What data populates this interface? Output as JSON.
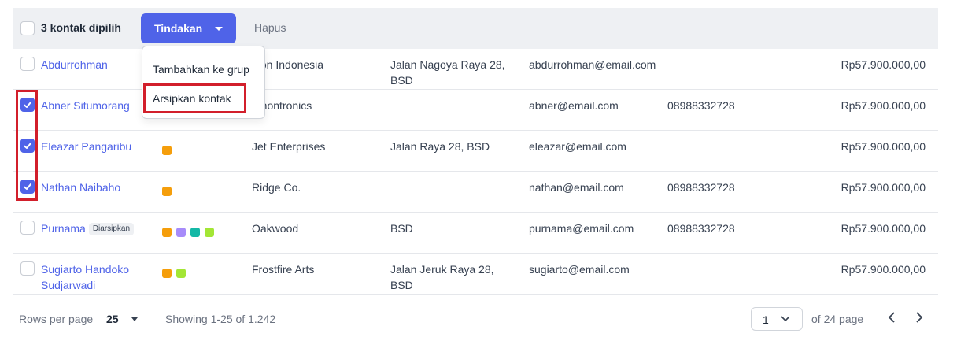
{
  "header": {
    "selected_text": "3 kontak dipilih",
    "actions_label": "Tindakan",
    "delete_label": "Hapus"
  },
  "dropdown": {
    "items": [
      "Tambahkan ke grup",
      "Arsipkan kontak"
    ]
  },
  "rows": [
    {
      "name": "Abdurrohman",
      "checked": false,
      "tags": [],
      "company": "Lion Indonesia",
      "address": "Jalan Nagoya Raya 28, BSD",
      "email": "abdurrohman@email.com",
      "phone": "",
      "amount": "Rp57.900.000,00"
    },
    {
      "name": "Abner Situmorang",
      "checked": true,
      "tags": [],
      "company": "amontronics",
      "address": "",
      "email": "abner@email.com",
      "phone": "08988332728",
      "amount": "Rp57.900.000,00"
    },
    {
      "name": "Eleazar Pangaribu",
      "checked": true,
      "tags": [
        "#f59e0b"
      ],
      "company": "Jet Enterprises",
      "address": "Jalan Raya 28, BSD",
      "email": "eleazar@email.com",
      "phone": "",
      "amount": "Rp57.900.000,00"
    },
    {
      "name": "Nathan Naibaho",
      "checked": true,
      "tags": [
        "#f59e0b"
      ],
      "company": "Ridge Co.",
      "address": "",
      "email": "nathan@email.com",
      "phone": "08988332728",
      "amount": "Rp57.900.000,00"
    },
    {
      "name": "Purnama",
      "badge": "Diarsipkan",
      "checked": false,
      "tags": [
        "#f59e0b",
        "#a78bfa",
        "#14b8a6",
        "#a3e635"
      ],
      "company": "Oakwood",
      "address": "BSD",
      "email": "purnama@email.com",
      "phone": "08988332728",
      "amount": "Rp57.900.000,00"
    },
    {
      "name": "Sugiarto Handoko Sudjarwadi",
      "checked": false,
      "tags": [
        "#f59e0b",
        "#a3e635"
      ],
      "company": "Frostfire Arts",
      "address": "Jalan Jeruk Raya 28, BSD",
      "email": "sugiarto@email.com",
      "phone": "",
      "amount": "Rp57.900.000,00"
    }
  ],
  "footer": {
    "rows_per_page_label": "Rows per page",
    "rows_per_page_value": "25",
    "showing_text": "Showing 1-25 of 1.242",
    "current_page": "1",
    "of_pages_text": "of 24 page"
  },
  "colors": {
    "accent": "#4f63e8",
    "highlight": "#d21f2b"
  }
}
